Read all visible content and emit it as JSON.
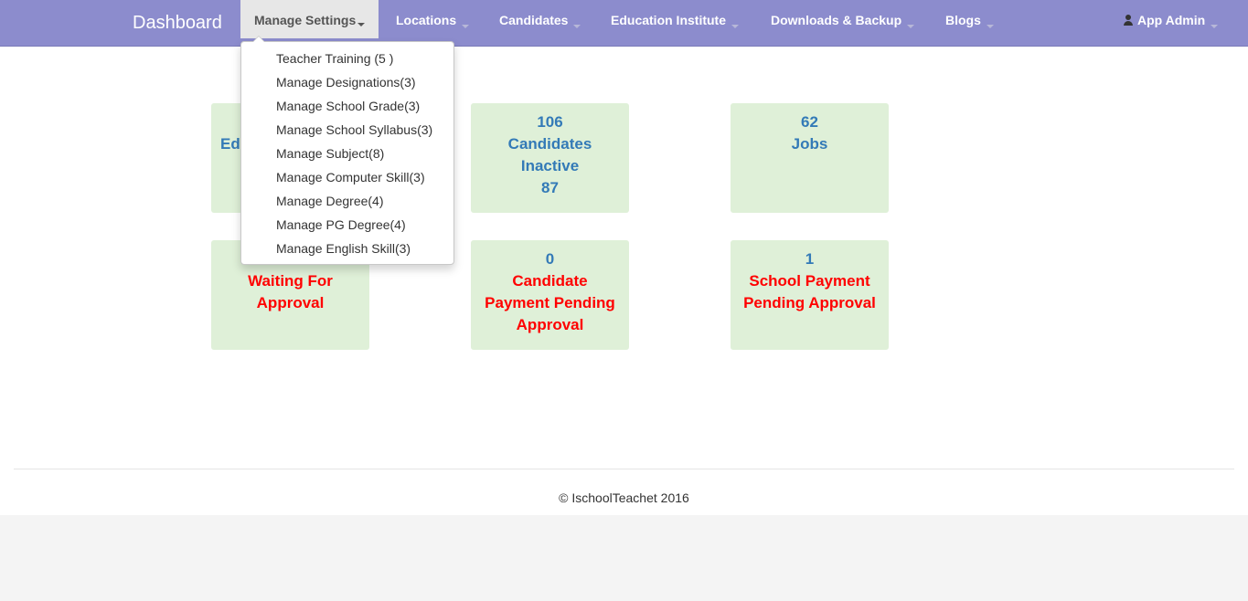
{
  "navbar": {
    "brand": "Dashboard",
    "items": [
      {
        "label": "Manage Settings"
      },
      {
        "label": "Locations"
      },
      {
        "label": "Candidates"
      },
      {
        "label": "Education Institute"
      },
      {
        "label": "Downloads & Backup"
      },
      {
        "label": "Blogs"
      }
    ],
    "user": "App Admin"
  },
  "dropdown": {
    "items": [
      "Teacher Training (5 )",
      "Manage Designations(3)",
      "Manage School Grade(3)",
      "Manage School Syllabus(3)",
      "Manage Subject(8)",
      "Manage Computer Skill(3)",
      "Manage Degree(4)",
      "Manage PG Degree(4)",
      "Manage English Skill(3)"
    ]
  },
  "cards": {
    "edu": {
      "partial_label": "Ed"
    },
    "candidates": {
      "count": "106",
      "label": "Candidates",
      "inactive_label": "Inactive",
      "inactive_count": "87"
    },
    "jobs": {
      "count": "62",
      "label": "Jobs"
    },
    "waiting": {
      "line1": "Waiting For",
      "line2": "Approval"
    },
    "candidate_payment": {
      "count": "0",
      "line1": "Candidate",
      "line2": "Payment Pending",
      "line3": "Approval"
    },
    "school_payment": {
      "count": "1",
      "line1": "School Payment",
      "line2": "Pending Approval"
    }
  },
  "footer": {
    "text": "© IschoolTeachet 2016"
  },
  "colors": {
    "navbar": "#8c8ccd",
    "card_bg": "#dff0d8",
    "blue_text": "#337ab7",
    "red_text": "#ff0000"
  }
}
